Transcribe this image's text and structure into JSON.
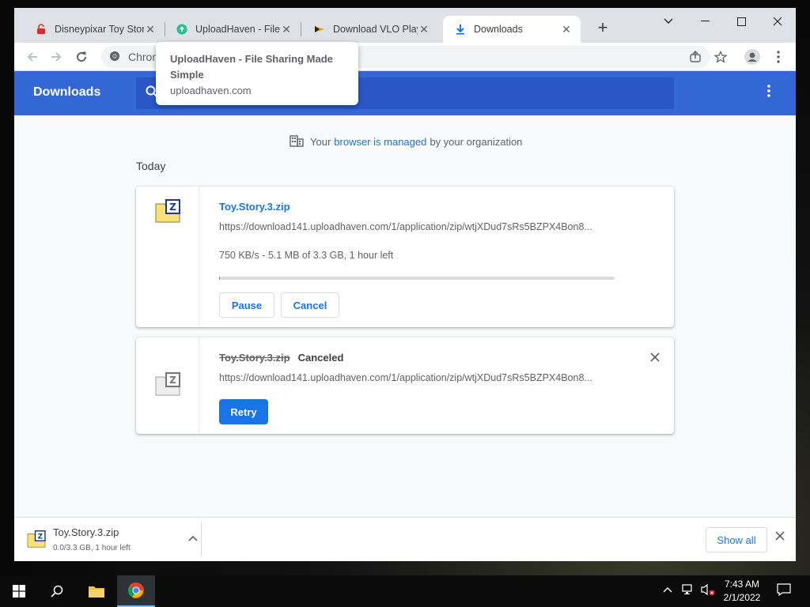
{
  "browser": {
    "tabs": [
      {
        "title": "Disneypixar Toy Story",
        "icon": "red-lock-icon",
        "active": false
      },
      {
        "title": "UploadHaven - File Sharing Made Simple",
        "icon": "uploadhaven-icon",
        "active": false
      },
      {
        "title": "Download VLO Player",
        "icon": "vlo-icon",
        "active": false
      },
      {
        "title": "Downloads",
        "icon": "download-icon",
        "active": true
      }
    ],
    "omnibox_text": "Chrome",
    "tooltip": {
      "title": "UploadHaven - File Sharing Made Simple",
      "domain": "uploadhaven.com"
    }
  },
  "downloads_page": {
    "header_title": "Downloads",
    "managed_notice": {
      "prefix": "Your",
      "link": "browser is managed",
      "suffix": "by your organization"
    },
    "section_label": "Today",
    "items": [
      {
        "filename": "Toy.Story.3.zip",
        "url": "https://download141.uploadhaven.com/1/application/zip/wtjXDud7sRs5BZPX4Bon8...",
        "status": "750 KB/s - 5.1 MB of 3.3 GB, 1 hour left",
        "progress_fraction": 0.0015,
        "buttons": [
          "Pause",
          "Cancel"
        ]
      },
      {
        "filename": "Toy.Story.3.zip",
        "state_label": "Canceled",
        "url": "https://download141.uploadhaven.com/1/application/zip/wtjXDud7sRs5BZPX4Bon8...",
        "buttons": [
          "Retry"
        ]
      }
    ]
  },
  "download_shelf": {
    "filename": "Toy.Story.3.zip",
    "status": "0.0/3.3 GB, 1 hour left",
    "show_all": "Show all"
  },
  "taskbar": {
    "time": "7:43 AM",
    "date": "2/1/2022"
  },
  "colors": {
    "accent": "#1a73e8",
    "header_blue": "#3367d6",
    "search_blue": "#2a56c6"
  }
}
